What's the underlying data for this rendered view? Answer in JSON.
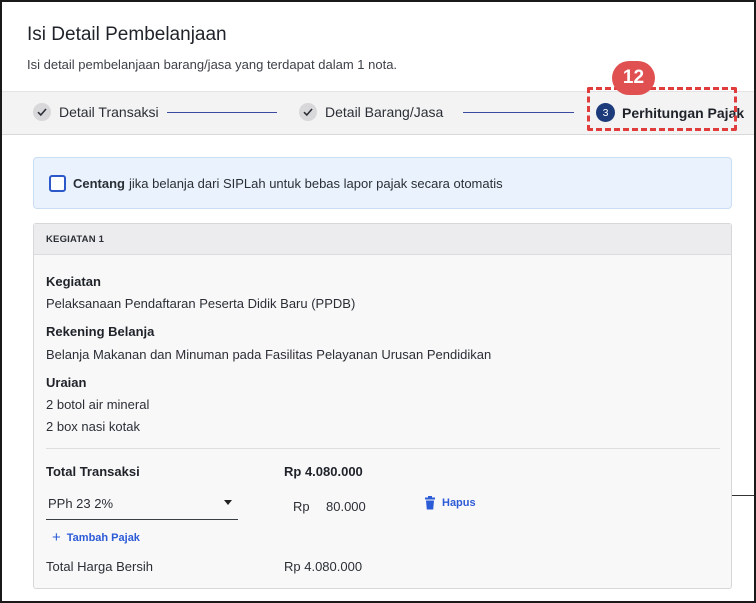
{
  "header": {
    "title": "Isi Detail Pembelanjaan",
    "subtitle": "Isi detail pembelanjaan barang/jasa yang terdapat dalam 1 nota."
  },
  "stepper": {
    "steps": [
      {
        "label": "Detail Transaksi",
        "state": "done"
      },
      {
        "label": "Detail Barang/Jasa",
        "state": "done"
      },
      {
        "number": "3",
        "label": "Perhitungan Pajak",
        "state": "active"
      }
    ]
  },
  "annotation": {
    "badge": "12",
    "color": "#e03c3c"
  },
  "notice": {
    "bold": "Centang",
    "text": "jika belanja dari SIPLah untuk bebas lapor pajak secara otomatis",
    "checked": false
  },
  "card": {
    "header": "KEGIATAN 1",
    "kegiatan_label": "Kegiatan",
    "kegiatan_value": "Pelaksanaan Pendaftaran Peserta Didik Baru (PPDB)",
    "rekening_label": "Rekening Belanja",
    "rekening_value": "Belanja Makanan dan Minuman pada Fasilitas Pelayanan Urusan Pendidikan",
    "uraian_label": "Uraian",
    "uraian_items": [
      "2 botol air mineral",
      "2 box nasi kotak"
    ],
    "total_label": "Total Transaksi",
    "total_value": "Rp 4.080.000",
    "tax_select": "PPh 23 2%",
    "tax_currency": "Rp",
    "tax_amount": "80.000",
    "delete_label": "Hapus",
    "add_tax_label": "Tambah Pajak",
    "net_label": "Total Harga Bersih",
    "net_value": "Rp 4.080.000"
  },
  "colors": {
    "accent": "#2c5bd6",
    "step_active": "#1d3b7a"
  }
}
